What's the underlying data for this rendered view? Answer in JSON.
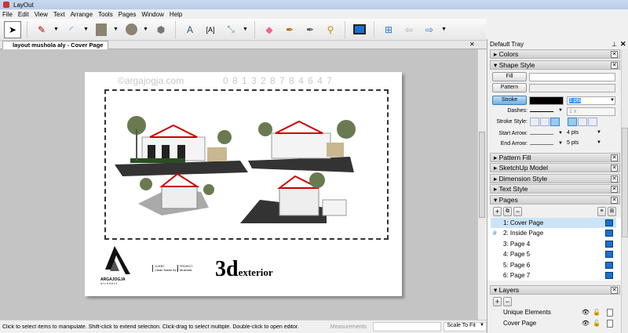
{
  "app": {
    "title": "LayOut"
  },
  "menu": [
    "File",
    "Edit",
    "View",
    "Text",
    "Arrange",
    "Tools",
    "Pages",
    "Window",
    "Help"
  ],
  "document_tab": "layout mushola aly - Cover Page",
  "page": {
    "watermark": "©argajogja.com",
    "phone": "0 8 1 3 2 8 7 8 4 6 4 7",
    "logo_text": "ARGAJOGJA",
    "logo_sub": "a r c h i t e c t",
    "client_label": "CLIENT",
    "client_value": "Clean Name ALY",
    "project_label": "PROJECT",
    "project_value": "Mushola",
    "title_big": "3d",
    "title_small": "exterior"
  },
  "status": {
    "hint": "Click to select items to manipulate. Shift-click to extend selection. Click-drag to select multiple. Double-click to open editor.",
    "measurements_label": "Measurements",
    "measurements_value": "",
    "zoom": "Scale To Fit"
  },
  "tray": {
    "title": "Default Tray",
    "sections": {
      "colors": "Colors",
      "shape_style": "Shape Style",
      "pattern_fill": "Pattern Fill",
      "sketchup_model": "SketchUp Model",
      "dimension_style": "Dimension Style",
      "text_style": "Text Style",
      "pages": "Pages",
      "layers": "Layers"
    },
    "shape_style": {
      "fill": "Fill",
      "pattern": "Pattern",
      "stroke": "Stroke",
      "stroke_color": "#000000",
      "stroke_width": "1 pts",
      "dashes_label": "Dashes:",
      "dash_scale": "1 x",
      "stroke_style_label": "Stroke Style:",
      "start_arrow_label": "Start Arrow:",
      "start_arrow_size": "4 pts",
      "end_arrow_label": "End Arrow:",
      "end_arrow_size": "5 pts"
    },
    "pages": [
      {
        "label": "1: Cover Page",
        "selected": true
      },
      {
        "label": "2: Inside Page",
        "marker": "#"
      },
      {
        "label": "3: Page 4"
      },
      {
        "label": "4: Page 5"
      },
      {
        "label": "5: Page 6"
      },
      {
        "label": "6: Page 7"
      }
    ],
    "layers": [
      {
        "label": "Unique Elements"
      },
      {
        "label": "Cover Page"
      }
    ]
  }
}
